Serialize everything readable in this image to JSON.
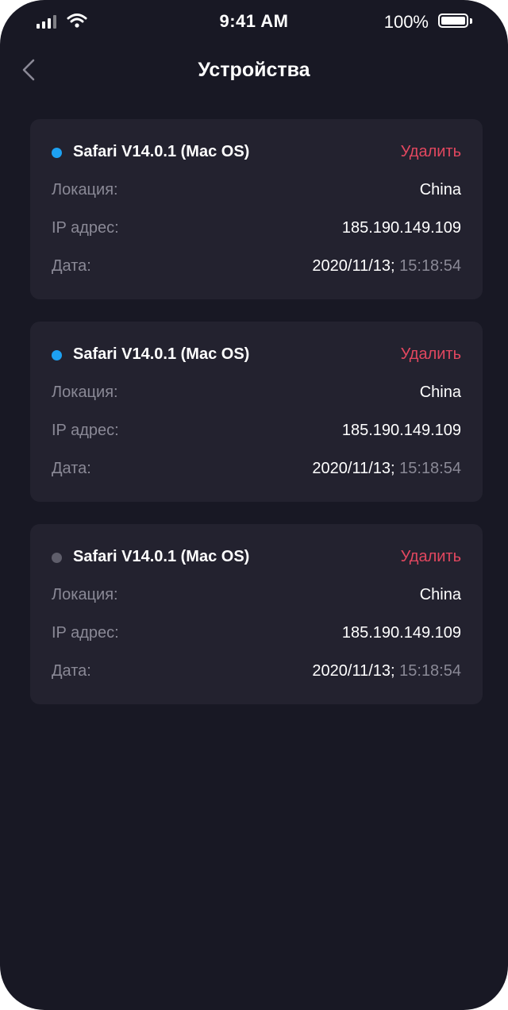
{
  "status_bar": {
    "time": "9:41 AM",
    "battery": "100%"
  },
  "header": {
    "title": "Устройства"
  },
  "colors": {
    "active": "#1da1f2",
    "inactive": "#5f5e6b",
    "delete": "#e2475f"
  },
  "labels": {
    "location": "Локация:",
    "ip": "IP адрес:",
    "date": "Дата:",
    "delete": "Удалить"
  },
  "devices": [
    {
      "name": "Safari V14.0.1 (Mac OS)",
      "status": "active",
      "location": "China",
      "ip": "185.190.149.109",
      "date": "2020/11/13",
      "separator": ";",
      "time": " 15:18:54"
    },
    {
      "name": "Safari V14.0.1 (Mac OS)",
      "status": "active",
      "location": "China",
      "ip": "185.190.149.109",
      "date": "2020/11/13",
      "separator": ";",
      "time": " 15:18:54"
    },
    {
      "name": "Safari V14.0.1 (Mac OS)",
      "status": "inactive",
      "location": "China",
      "ip": "185.190.149.109",
      "date": "2020/11/13",
      "separator": ";",
      "time": " 15:18:54"
    }
  ]
}
